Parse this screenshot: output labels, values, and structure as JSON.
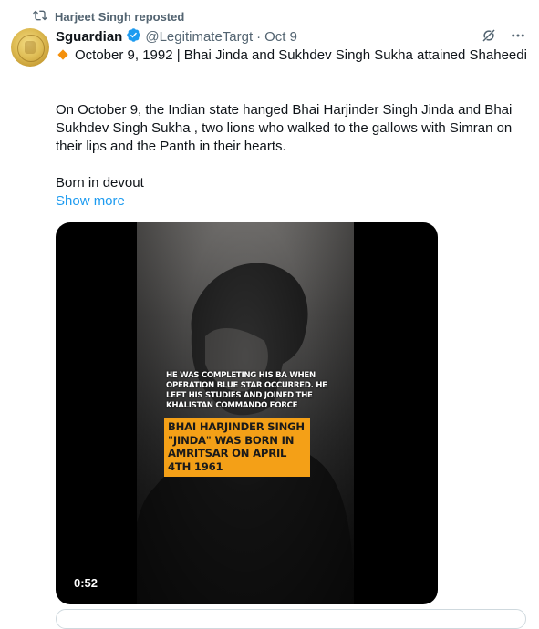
{
  "repost": {
    "label": "Harjeet Singh reposted",
    "icon": "repost-icon"
  },
  "author": {
    "name": "Sguardian",
    "handle": "@LegitimateTargt",
    "separator": "·",
    "date": "Oct 9",
    "verified_color": "#1d9bf0"
  },
  "tweet": {
    "line1": "October 9, 1992 | Bhai Jinda and Sukhdev Singh Sukha attained Shaheedi",
    "line2": "On October 9, the Indian state hanged Bhai Harjinder Singh Jinda and Bhai Sukhdev Singh Sukha , two lions who walked to the gallows with Simran on their lips and the Panth in their hearts.",
    "line3": "Born in devout",
    "show_more": "Show more"
  },
  "video": {
    "caption": "HE WAS COMPLETING HIS BA WHEN OPERATION BLUE STAR OCCURRED. HE LEFT HIS STUDIES AND JOINED THE KHALISTAN COMMANDO FORCE",
    "highlight": "BHAI HARJINDER SINGH \"JINDA\" WAS BORN IN AMRITSAR ON APRIL 4TH 1961",
    "duration": "0:52"
  },
  "colors": {
    "accent": "#1d9bf0",
    "muted": "#536471",
    "highlight_bg": "#f4a017"
  }
}
